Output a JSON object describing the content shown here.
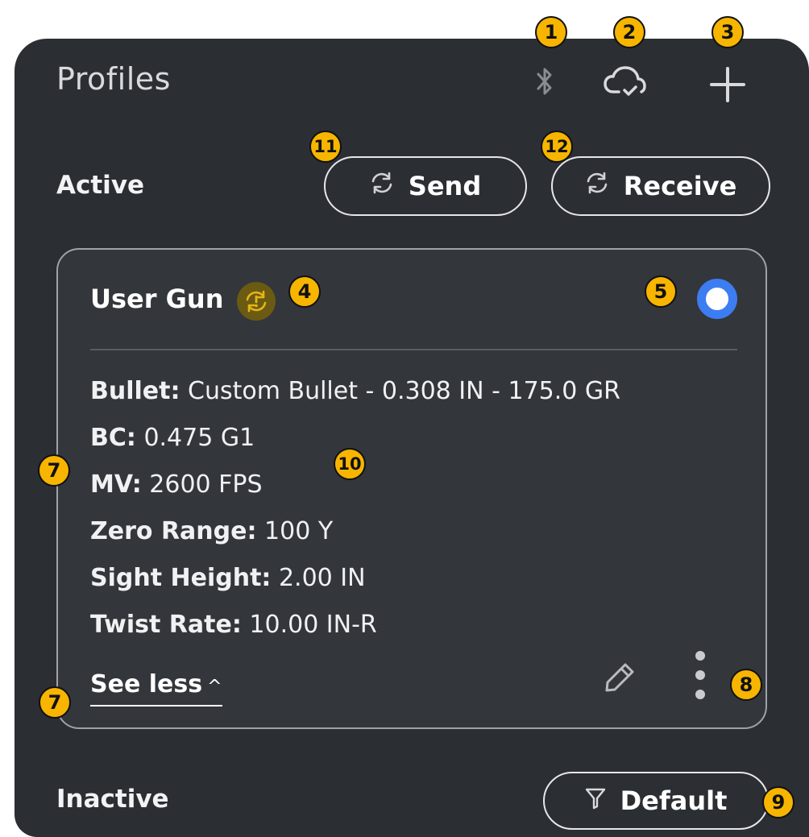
{
  "header": {
    "title": "Profiles",
    "icons": [
      "bluetooth-icon",
      "cloud-sync-icon",
      "plus-icon"
    ]
  },
  "active": {
    "label": "Active",
    "send_label": "Send",
    "receive_label": "Receive"
  },
  "profile_card": {
    "name": "User Gun",
    "selected": true,
    "specs": [
      {
        "label": "Bullet:",
        "value": "Custom Bullet - 0.308 IN - 175.0 GR"
      },
      {
        "label": "BC:",
        "value": "0.475 G1"
      },
      {
        "label": "MV:",
        "value": "2600 FPS"
      },
      {
        "label": "Zero Range:",
        "value": "100 Y"
      },
      {
        "label": "Sight Height:",
        "value": "2.00 IN"
      },
      {
        "label": "Twist Rate:",
        "value": "10.00 IN-R"
      }
    ],
    "see_less_label": "See less",
    "see_less_chevron": "^"
  },
  "inactive": {
    "label": "Inactive",
    "filter_label": "Default"
  },
  "callouts": [
    "1",
    "2",
    "3",
    "4",
    "5",
    "7",
    "7",
    "8",
    "9",
    "10",
    "11",
    "12"
  ],
  "colors": {
    "background": "#2b2e33",
    "card": "#33363b",
    "accent_blue": "#3d7df2",
    "callout": "#f7b500"
  }
}
